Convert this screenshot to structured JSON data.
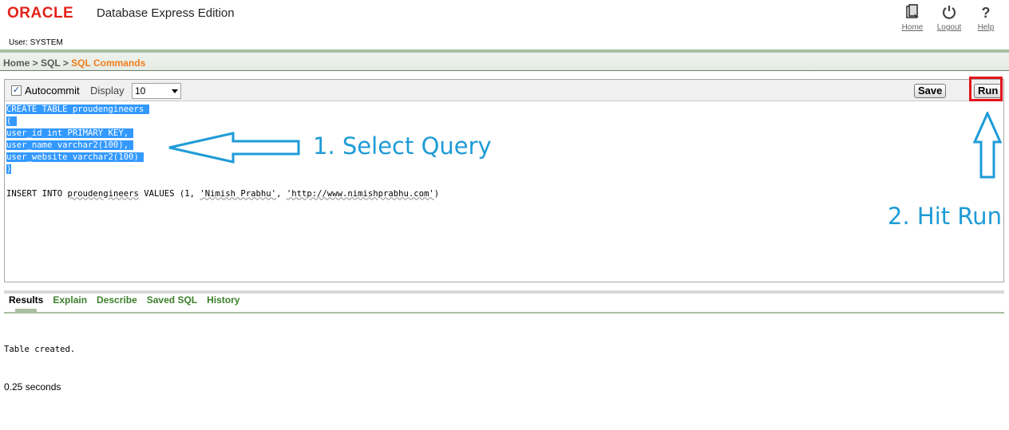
{
  "header": {
    "brand": "ORACLE",
    "product": "Database Express Edition",
    "user": "User: SYSTEM",
    "links": [
      {
        "label": "Home",
        "icon": "home-icon"
      },
      {
        "label": "Logout",
        "icon": "power-icon"
      },
      {
        "label": "Help",
        "icon": "question-icon"
      }
    ]
  },
  "breadcrumb": {
    "home": "Home",
    "sep1": " > ",
    "sql": "SQL",
    "sep2": " > ",
    "current": "SQL Commands"
  },
  "toolbar": {
    "autocommit_label": "Autocommit",
    "autocommit_checked": true,
    "display_label": "Display",
    "display_value": "10",
    "save_label": "Save",
    "run_label": "Run"
  },
  "editor": {
    "selected_lines": [
      "CREATE TABLE proudengineers ",
      "( ",
      "user_id int PRIMARY KEY, ",
      "user_name varchar2(100), ",
      "user_website varchar2(100) ",
      ")"
    ],
    "insert_parts": [
      "INSERT INTO ",
      "proudengineers",
      " VALUES (1, ",
      "'Nimish Prabhu'",
      ", ",
      "'http://www.nimishprabhu.com'",
      ")"
    ]
  },
  "annotations": {
    "step1": "1. Select Query",
    "step2": "2. Hit Run",
    "color": "#1e9bd7",
    "highlight_color": "#e3141b"
  },
  "tabs": [
    {
      "label": "Results",
      "active": true
    },
    {
      "label": "Explain",
      "active": false
    },
    {
      "label": "Describe",
      "active": false
    },
    {
      "label": "Saved SQL",
      "active": false
    },
    {
      "label": "History",
      "active": false
    }
  ],
  "results": {
    "message": "Table created.",
    "elapsed": "0.25 seconds"
  }
}
